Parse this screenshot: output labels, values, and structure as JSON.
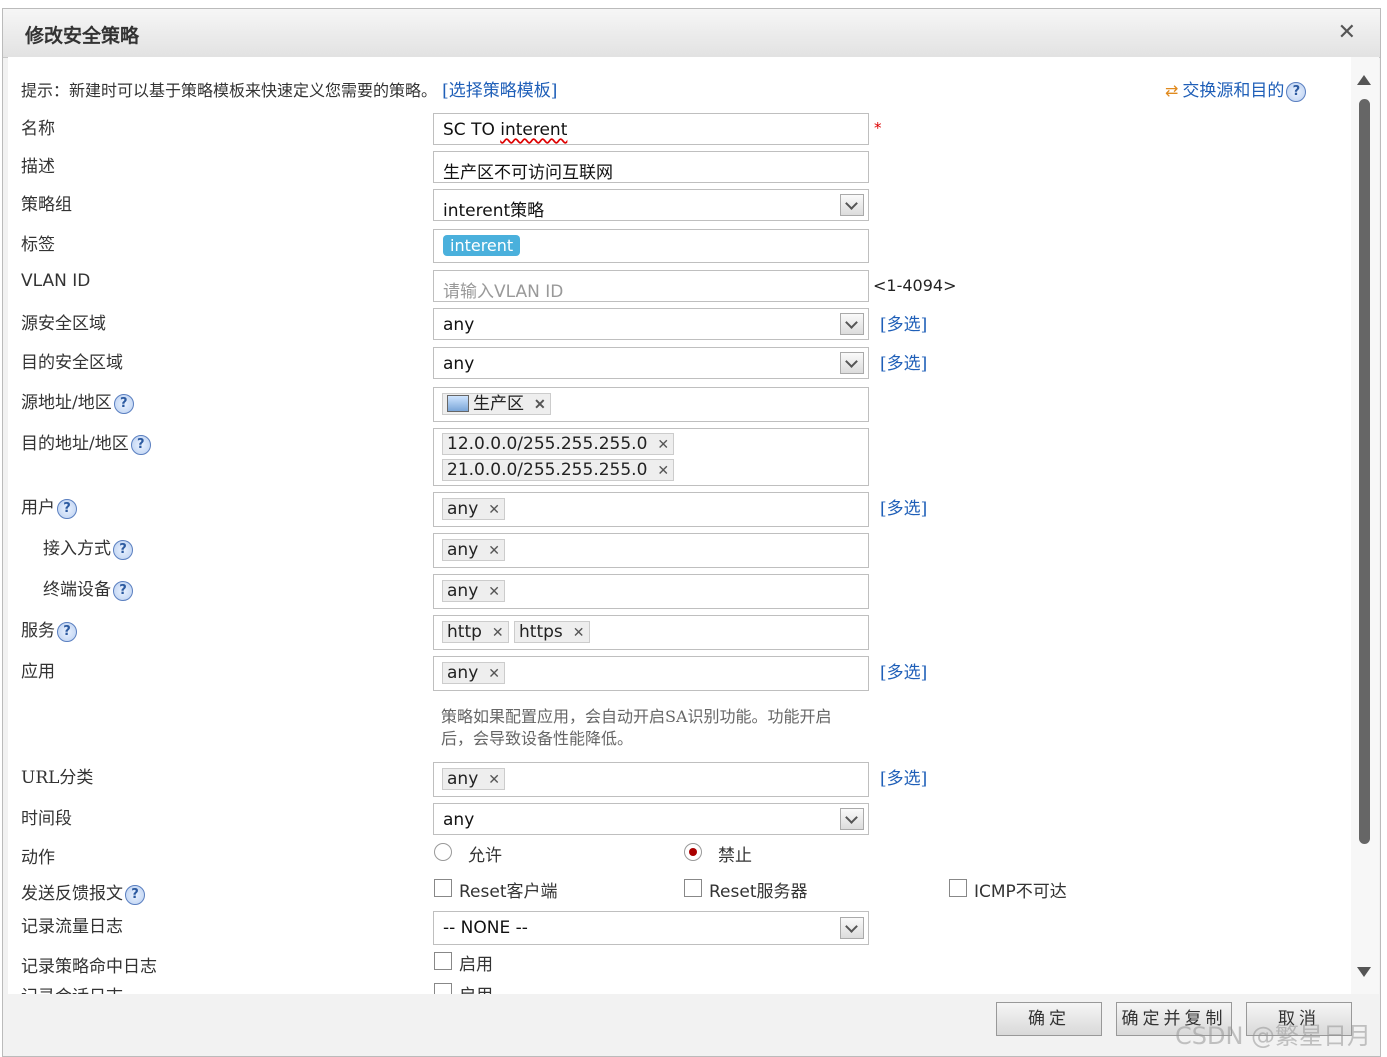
{
  "dialog": {
    "title": "修改安全策略"
  },
  "hint": {
    "text": "提示：新建时可以基于策略模板来快速定义您需要的策略。",
    "template_link": "[选择策略模板]",
    "swap_link": "交换源和目的"
  },
  "form": {
    "name": {
      "label": "名称",
      "value": "SC TO ",
      "value_wavy": "interent",
      "required": "*"
    },
    "description": {
      "label": "描述",
      "value": "生产区不可访问互联网"
    },
    "policy_group": {
      "label": "策略组",
      "value": "interent策略"
    },
    "tag": {
      "label": "标签",
      "chip": "interent"
    },
    "vlan": {
      "label": "VLAN ID",
      "placeholder": "请输入VLAN ID",
      "range": "<1-4094>"
    },
    "src_zone": {
      "label": "源安全区域",
      "value": "any",
      "multi": "[多选]"
    },
    "dst_zone": {
      "label": "目的安全区域",
      "value": "any",
      "multi": "[多选]"
    },
    "src_addr": {
      "label": "源地址/地区",
      "chip": "生产区"
    },
    "dst_addr": {
      "label": "目的地址/地区",
      "chips": [
        "12.0.0.0/255.255.255.0",
        "21.0.0.0/255.255.255.0"
      ]
    },
    "user": {
      "label": "用户",
      "chip": "any",
      "multi": "[多选]"
    },
    "access_method": {
      "label": "接入方式",
      "chip": "any"
    },
    "terminal": {
      "label": "终端设备",
      "chip": "any"
    },
    "service": {
      "label": "服务",
      "chips": [
        "http",
        "https"
      ]
    },
    "application": {
      "label": "应用",
      "chip": "any",
      "multi": "[多选]",
      "note_line1": "策略如果配置应用，会自动开启SA识别功能。功能开启",
      "note_line2": "后，会导致设备性能降低。"
    },
    "url_category": {
      "label": "URL分类",
      "chip": "any",
      "multi": "[多选]"
    },
    "time_range": {
      "label": "时间段",
      "value": "any"
    },
    "action": {
      "label": "动作",
      "allow": "允许",
      "deny": "禁止",
      "selected": "禁止"
    },
    "feedback": {
      "label": "发送反馈报文",
      "opt1": "Reset客户端",
      "opt2": "Reset服务器",
      "opt3": "ICMP不可达"
    },
    "traffic_log": {
      "label": "记录流量日志",
      "value": "-- NONE --"
    },
    "hit_log": {
      "label": "记录策略命中日志",
      "opt": "启用"
    },
    "session_log": {
      "label": "记录会话日志",
      "opt": "启用"
    }
  },
  "buttons": {
    "ok": "确定",
    "ok_copy": "确定并复制",
    "cancel": "取消"
  },
  "watermark": "CSDN @繁星日月",
  "colors": {
    "link": "#1f5fb8",
    "tag": "#4ab0dc",
    "required": "#dd0000"
  },
  "icons": [
    "close-icon",
    "swap-icon",
    "help-icon",
    "chevron-down-icon",
    "computer-icon",
    "remove-icon",
    "scroll-up-icon",
    "scroll-down-icon"
  ]
}
